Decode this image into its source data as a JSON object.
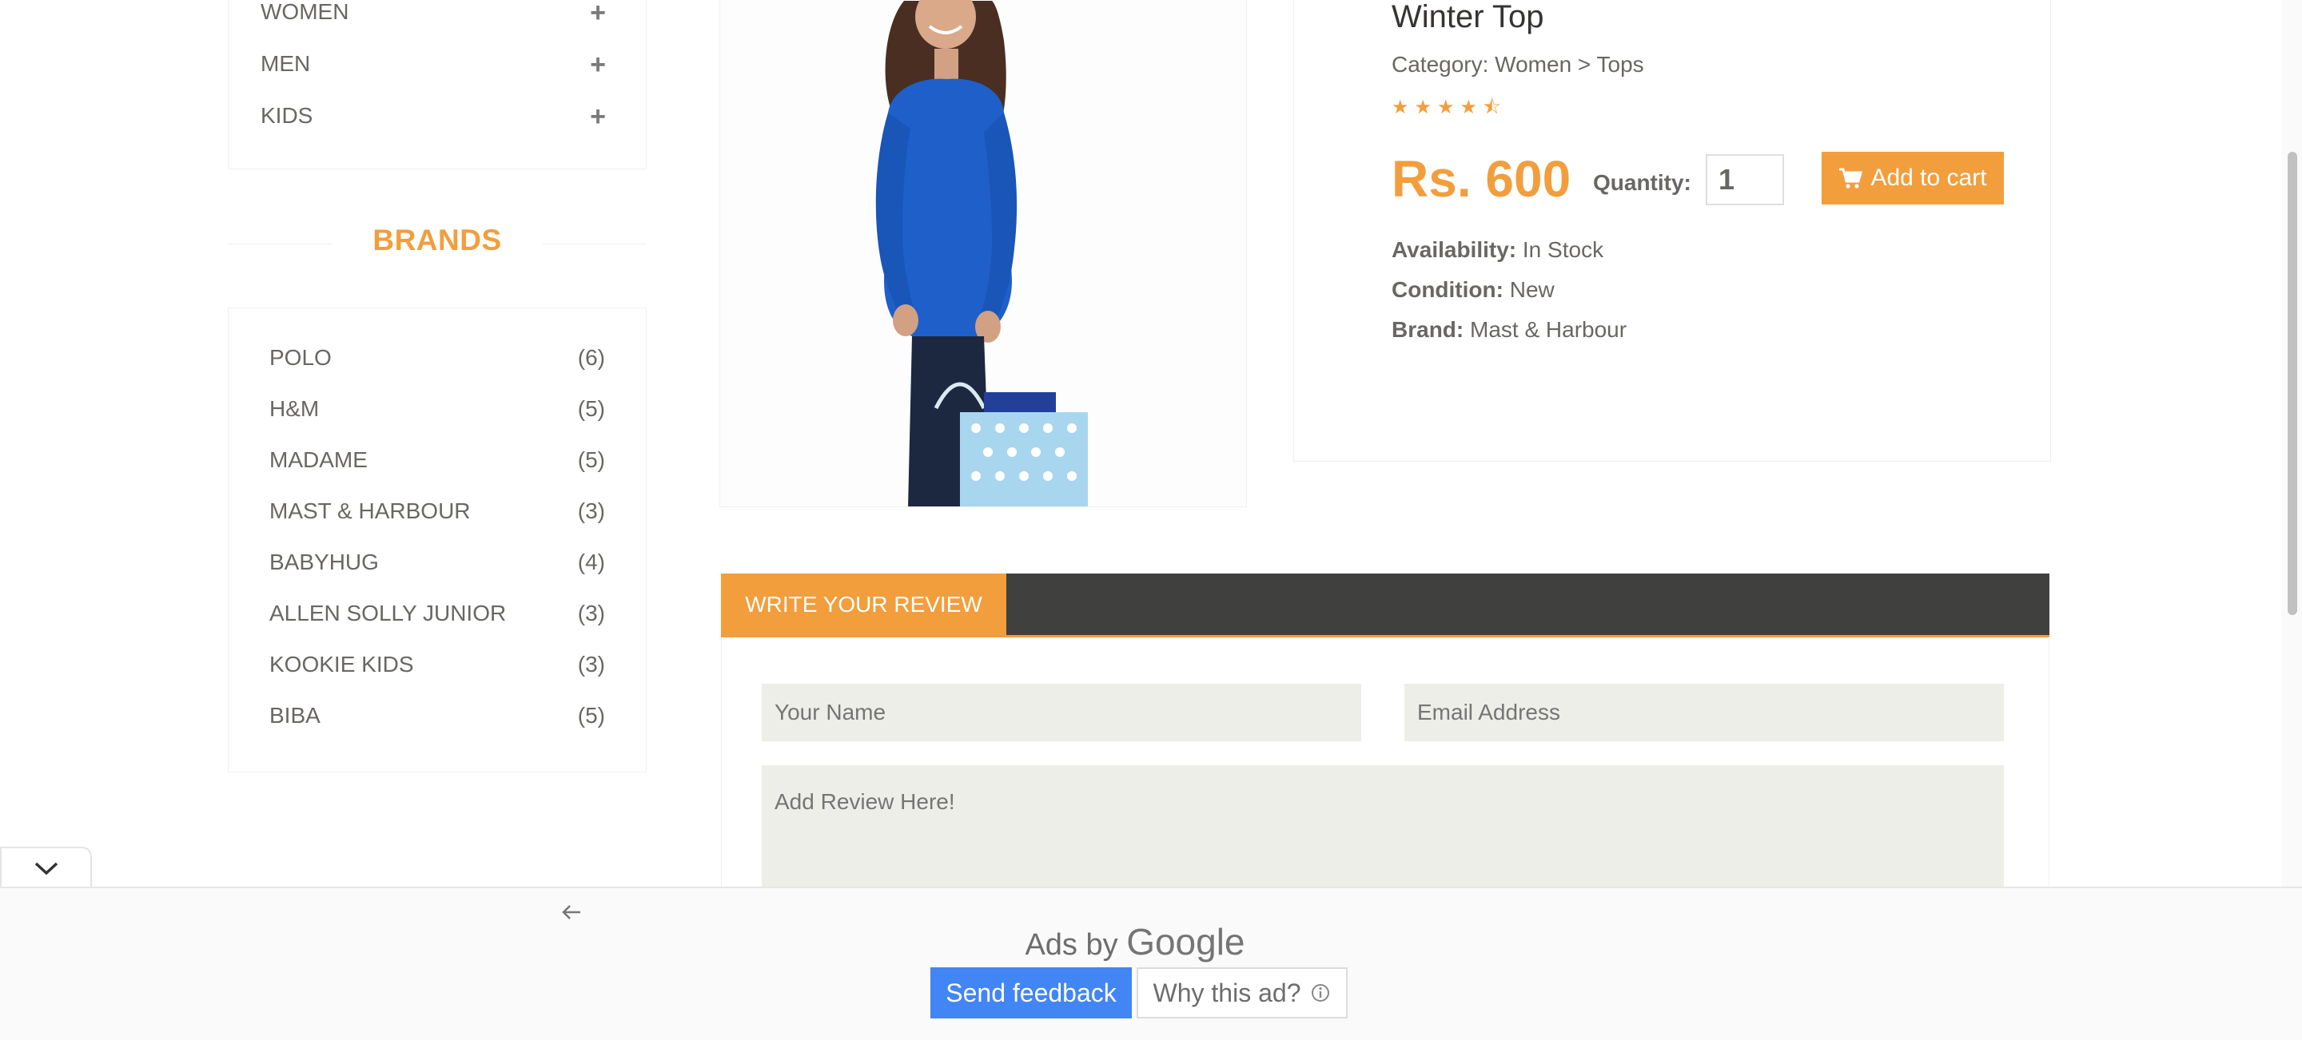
{
  "sidebar": {
    "categories": [
      {
        "label": "WOMEN",
        "icon": "+"
      },
      {
        "label": "MEN",
        "icon": "+"
      },
      {
        "label": "KIDS",
        "icon": "+"
      }
    ],
    "brands_title": "BRANDS",
    "brands": [
      {
        "name": "POLO",
        "count": "(6)"
      },
      {
        "name": "H&M",
        "count": "(5)"
      },
      {
        "name": "MADAME",
        "count": "(5)"
      },
      {
        "name": "MAST & HARBOUR",
        "count": "(3)"
      },
      {
        "name": "BABYHUG",
        "count": "(4)"
      },
      {
        "name": "ALLEN SOLLY JUNIOR",
        "count": "(3)"
      },
      {
        "name": "KOOKIE KIDS",
        "count": "(3)"
      },
      {
        "name": "BIBA",
        "count": "(5)"
      }
    ]
  },
  "product": {
    "title": "Winter Top",
    "category": "Category: Women > Tops",
    "rating": "★★★★⯪",
    "price": "Rs. 600",
    "quantity_label": "Quantity:",
    "quantity": "1",
    "add_to_cart": "Add to cart",
    "availability_label": "Availability:",
    "availability": " In Stock",
    "condition_label": "Condition:",
    "condition": " New",
    "brand_label": "Brand:",
    "brand": " Mast & Harbour"
  },
  "review": {
    "tab_label": "WRITE YOUR REVIEW",
    "name_placeholder": "Your Name",
    "email_placeholder": "Email Address",
    "review_placeholder": "Add Review Here!"
  },
  "ad": {
    "toggle_icon": "chevron-down-icon",
    "back_icon": "arrow-left-icon",
    "ads_by": "Ads by ",
    "google": "Google",
    "send_feedback": "Send feedback",
    "why_this_ad": "Why this ad?"
  },
  "colors": {
    "accent": "#f29e3d",
    "dark_bar": "#40403e",
    "feedback_blue": "#4285f4",
    "input_bg": "#eeeee8"
  }
}
